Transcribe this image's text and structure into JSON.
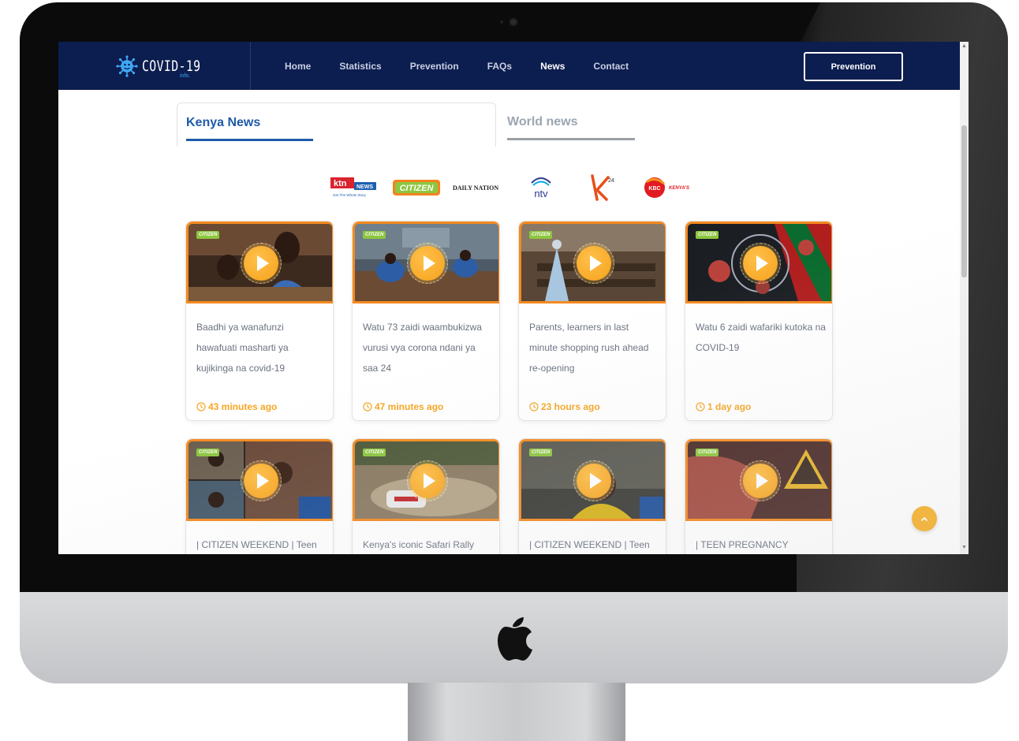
{
  "brand": {
    "name": "COVID-19",
    "subtitle": "info."
  },
  "nav": {
    "items": [
      "Home",
      "Statistics",
      "Prevention",
      "FAQs",
      "News",
      "Contact"
    ],
    "active": "News",
    "cta_label": "Prevention"
  },
  "tabs": {
    "kenya": "Kenya News",
    "world": "World news",
    "active": "Kenya News"
  },
  "channels": [
    {
      "name": "KTN News",
      "logo_text": "ktn",
      "logo_sub": "NEWS",
      "tagline": "Get The Whole Story"
    },
    {
      "name": "Citizen",
      "logo_text": "CITIZEN"
    },
    {
      "name": "Daily Nation",
      "logo_text": "DAILY NATION"
    },
    {
      "name": "NTV",
      "logo_text": "ntv"
    },
    {
      "name": "K24",
      "logo_text": "K24"
    },
    {
      "name": "KBC",
      "logo_text": "KBC",
      "logo_sub": "KENYA'S"
    }
  ],
  "badge": "CITIZEN",
  "videos": [
    {
      "title": "Baadhi ya wanafunzi hawafuati masharti ya kujikinga na covid-19",
      "time": "43 minutes ago"
    },
    {
      "title": "Watu 73 zaidi waambukizwa vurusi vya corona ndani ya saa 24",
      "time": "47 minutes ago"
    },
    {
      "title": "Parents, learners in last minute shopping rush ahead re-opening",
      "time": "23 hours ago"
    },
    {
      "title": "Watu 6 zaidi wafariki kutoka na COVID-19",
      "time": "1 day ago"
    },
    {
      "title": "| CITIZEN WEEKEND | Teen",
      "time": ""
    },
    {
      "title": "Kenya's iconic Safari Rally",
      "time": ""
    },
    {
      "title": "| CITIZEN WEEKEND | Teen",
      "time": ""
    },
    {
      "title": "| TEEN PREGNANCY",
      "time": ""
    }
  ],
  "colors": {
    "navbar": "#0c1d4f",
    "accent_orange": "#f48a1f",
    "time_orange": "#f5a623",
    "tab_blue": "#1f5aa8"
  },
  "icons": {
    "play": "play-icon",
    "clock": "clock-icon",
    "back_to_top": "chevron-up-icon"
  }
}
